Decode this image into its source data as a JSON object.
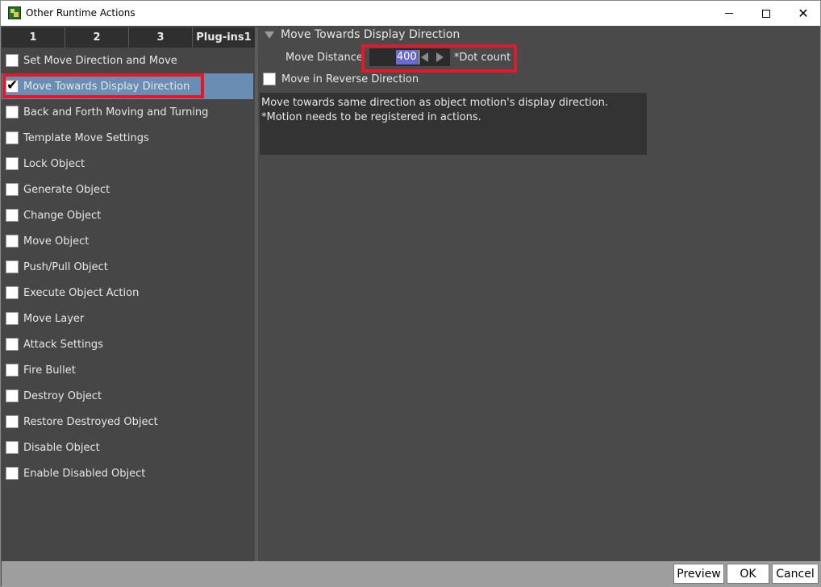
{
  "window": {
    "title": "Other Runtime Actions",
    "controls": {
      "minimize": "minimize",
      "maximize": "maximize",
      "close": "✕"
    }
  },
  "tabs": [
    "1",
    "2",
    "3",
    "Plug-ins1"
  ],
  "actions": [
    {
      "label": "Set Move Direction and Move",
      "checked": false
    },
    {
      "label": "Move Towards Display Direction",
      "checked": true
    },
    {
      "label": "Back and Forth Moving and Turning",
      "checked": false
    },
    {
      "label": "Template Move Settings",
      "checked": false
    },
    {
      "label": "Lock Object",
      "checked": false
    },
    {
      "label": "Generate Object",
      "checked": false
    },
    {
      "label": "Change Object",
      "checked": false
    },
    {
      "label": "Move Object",
      "checked": false
    },
    {
      "label": "Push/Pull Object",
      "checked": false
    },
    {
      "label": "Execute Object Action",
      "checked": false
    },
    {
      "label": "Move Layer",
      "checked": false
    },
    {
      "label": "Attack Settings",
      "checked": false
    },
    {
      "label": "Fire Bullet",
      "checked": false
    },
    {
      "label": "Destroy Object",
      "checked": false
    },
    {
      "label": "Restore Destroyed Object",
      "checked": false
    },
    {
      "label": "Disable Object",
      "checked": false
    },
    {
      "label": "Enable Disabled Object",
      "checked": false
    }
  ],
  "detail": {
    "section_title": "Move Towards Display Direction",
    "distance_label": "Move Distance",
    "distance_value": "400",
    "distance_unit": "*Dot count",
    "reverse_label": "Move in Reverse Direction",
    "reverse_checked": false,
    "description_line1": "Move towards same direction as object motion's display direction.",
    "description_line2": "*Motion needs to be registered in actions."
  },
  "buttons": {
    "preview": "Preview",
    "ok": "OK",
    "cancel": "Cancel"
  },
  "colors": {
    "highlight_red": "#e2192a",
    "selection_blue": "#6a8db4",
    "panel_bg": "#4a4a4a"
  }
}
